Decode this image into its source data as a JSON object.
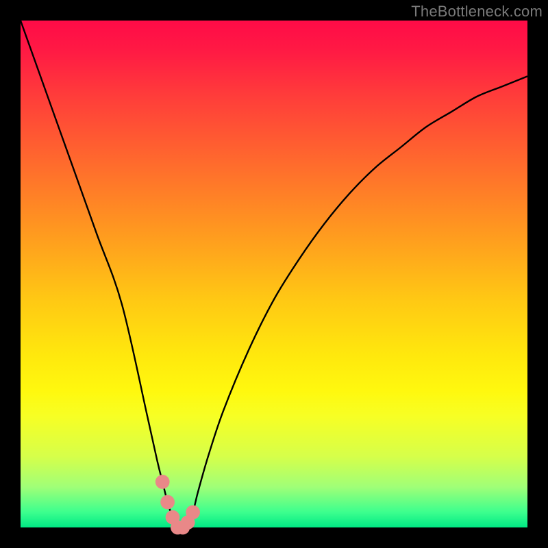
{
  "watermark_text": "TheBottleneck.com",
  "colors": {
    "curve_stroke": "#000000",
    "knot_fill": "#e98888",
    "frame_bg": "#000000"
  },
  "chart_data": {
    "type": "line",
    "title": "",
    "xlabel": "",
    "ylabel": "",
    "xlim": [
      0,
      100
    ],
    "ylim": [
      0,
      100
    ],
    "grid": false,
    "legend": false,
    "annotations": [
      {
        "text": "TheBottleneck.com",
        "position": "top-right"
      }
    ],
    "series": [
      {
        "name": "curve",
        "x": [
          0,
          5,
          10,
          15,
          20,
          25,
          27,
          28,
          29,
          30,
          31,
          32,
          33,
          34,
          35,
          37,
          40,
          45,
          50,
          55,
          60,
          65,
          70,
          75,
          80,
          85,
          90,
          95,
          100
        ],
        "values": [
          100,
          86,
          72,
          58,
          44,
          22,
          13,
          9,
          5,
          2,
          0,
          0,
          1,
          3,
          7,
          14,
          23,
          35,
          45,
          53,
          60,
          66,
          71,
          75,
          79,
          82,
          85,
          87,
          89
        ]
      }
    ],
    "knots_x": [
      28,
      29,
      30,
      31,
      32,
      33,
      34
    ],
    "knot_radius": 1.4
  }
}
